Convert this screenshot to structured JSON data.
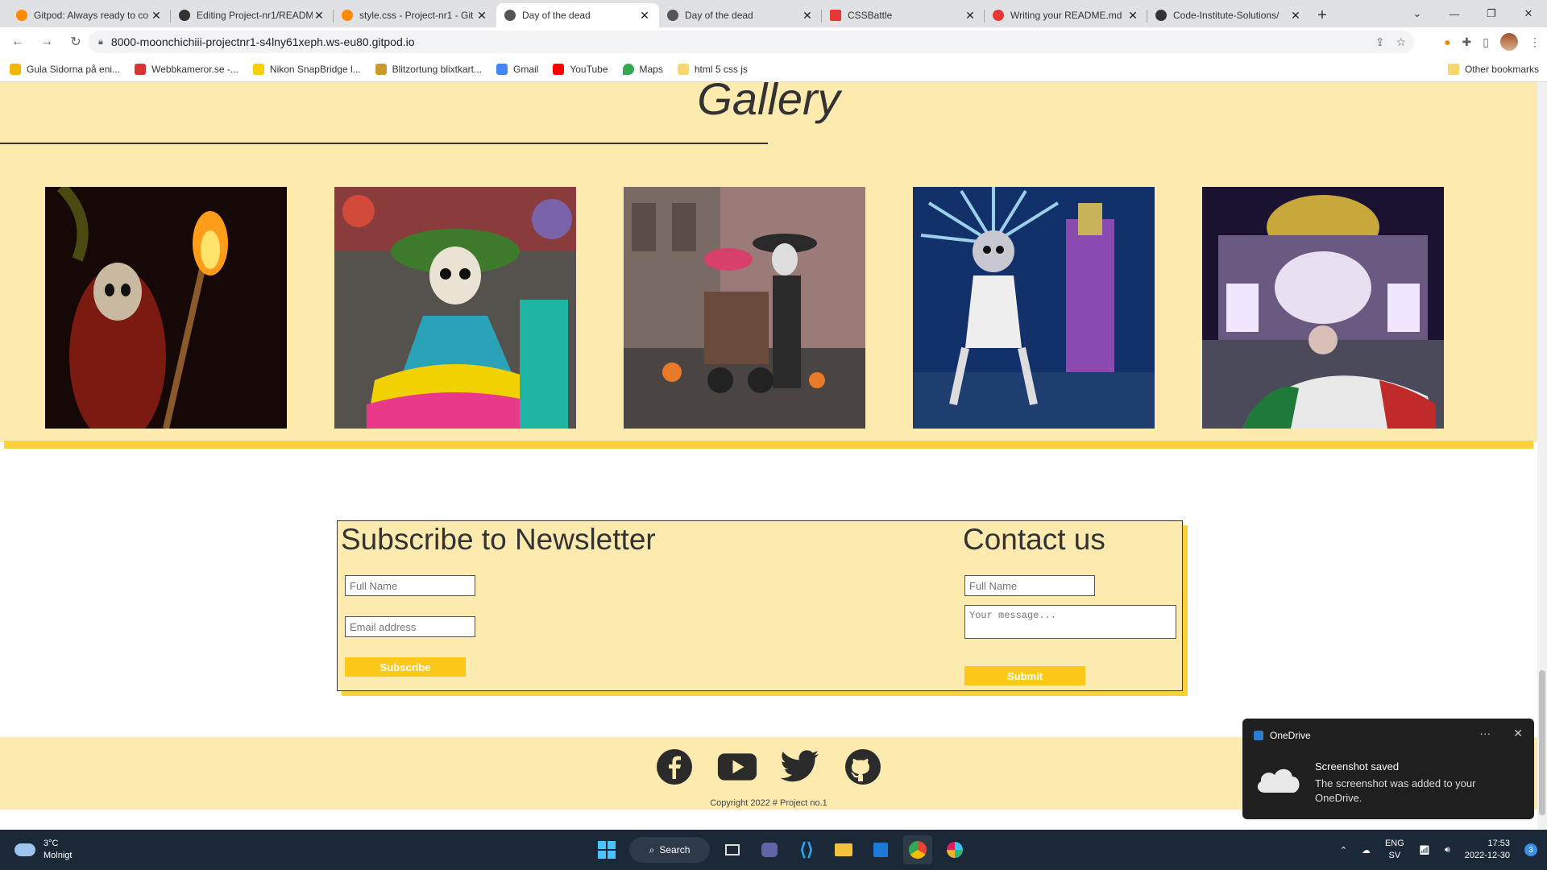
{
  "browser": {
    "tabs": [
      {
        "title": "Gitpod: Always ready to co",
        "favicon": "gitpod-icon",
        "active": false
      },
      {
        "title": "Editing Project-nr1/READM",
        "favicon": "github-icon",
        "active": false
      },
      {
        "title": "style.css - Project-nr1 - Git",
        "favicon": "gitpod-icon",
        "active": false
      },
      {
        "title": "Day of the dead",
        "favicon": "globe-icon",
        "active": true
      },
      {
        "title": "Day of the dead",
        "favicon": "globe-icon",
        "active": false
      },
      {
        "title": "CSSBattle",
        "favicon": "cssbattle-icon",
        "active": false
      },
      {
        "title": "Writing your README.md",
        "favicon": "opera-icon",
        "active": false
      },
      {
        "title": "Code-Institute-Solutions/",
        "favicon": "github-icon",
        "active": false
      }
    ],
    "url": "8000-moonchichiii-projectnr1-s4lny61xeph.ws-eu80.gitpod.io",
    "bookmarks": [
      {
        "label": "Gula Sidorna på eni...",
        "color": "#f2b705"
      },
      {
        "label": "Webbkameror.se -...",
        "color": "#d83232"
      },
      {
        "label": "Nikon SnapBridge l...",
        "color": "#f5d000"
      },
      {
        "label": "Blitzortung blixtkart...",
        "color": "#c89b2a"
      },
      {
        "label": "Gmail",
        "color": "#4285f4"
      },
      {
        "label": "YouTube",
        "color": "#ff0000"
      },
      {
        "label": "Maps",
        "color": "#34a853"
      },
      {
        "label": "html 5 css js",
        "color": "#f5d76e"
      }
    ],
    "other_bookmarks": "Other bookmarks"
  },
  "page": {
    "gallery_title": "Gallery",
    "newsletter": {
      "title": "Subscribe to Newsletter",
      "name_placeholder": "Full Name",
      "email_placeholder": "Email address",
      "button": "Subscribe"
    },
    "contact": {
      "title": "Contact us",
      "name_placeholder": "Full Name",
      "message_placeholder": "Your message...",
      "button": "Submit"
    },
    "footer": {
      "socials": [
        "facebook-icon",
        "youtube-icon",
        "twitter-icon",
        "github-icon"
      ],
      "copyright": "Copyright 2022 # Project no.1"
    },
    "colors": {
      "cream": "#fdeaae",
      "yellow": "#fcd13a",
      "button": "#fcc81a"
    }
  },
  "toast": {
    "app": "OneDrive",
    "title": "Screenshot saved",
    "body": "The screenshot was added to your OneDrive."
  },
  "taskbar": {
    "temp": "3°C",
    "weather": "Molnigt",
    "search": "Search",
    "lang": "ENG",
    "region": "SV",
    "time": "17:53",
    "date": "2022-12-30",
    "notifications": "3"
  }
}
